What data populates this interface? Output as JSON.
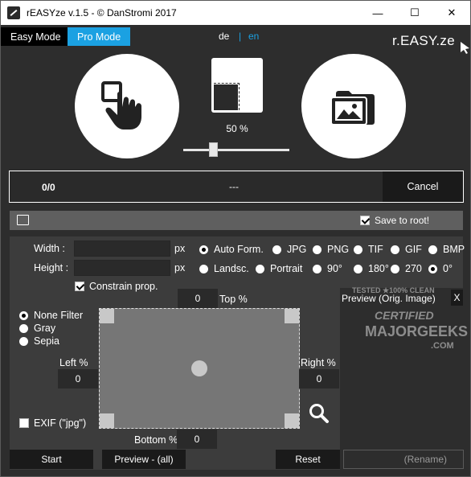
{
  "window": {
    "title": "rEASYze v.1.5 - © DanStromi 2017",
    "minimize": "—",
    "maximize": "☐",
    "close": "✕"
  },
  "modes": {
    "easy": "Easy Mode",
    "pro": "Pro Mode"
  },
  "languages": {
    "de": "de",
    "separator": "|",
    "en": "en"
  },
  "logo": "r.EASY.ze",
  "scale": {
    "percent_label": "50 %",
    "value_percent": 50
  },
  "progress": {
    "count": "0/0",
    "status": "---",
    "cancel": "Cancel"
  },
  "toolbar": {
    "save_to_root": "Save to root!",
    "save_to_root_checked": true
  },
  "size": {
    "width_label": "Width :",
    "height_label": "Height :",
    "unit": "px",
    "width_value": "",
    "height_value": ""
  },
  "format_options": [
    "Auto Form.",
    "JPG",
    "PNG",
    "TIF",
    "GIF",
    "BMP"
  ],
  "format_selected": "Auto Form.",
  "orientation_options": [
    "Landsc.",
    "Portrait",
    "90°",
    "180°",
    "270",
    "0°"
  ],
  "orientation_selected": "0°",
  "constrain": {
    "label": "Constrain prop.",
    "checked": true
  },
  "filters": {
    "options": [
      "None Filter",
      "Gray",
      "Sepia"
    ],
    "selected": "None Filter"
  },
  "crop": {
    "top_label": "Top %",
    "top_value": "0",
    "left_label": "Left %",
    "left_value": "0",
    "right_label": "Right %",
    "right_value": "0",
    "bottom_label": "Bottom %",
    "bottom_value": "0"
  },
  "exif": {
    "label": "EXIF (\"jpg\")",
    "checked": false
  },
  "preview": {
    "title": "Preview (Orig. Image)",
    "close": "X",
    "rename": "(Rename)"
  },
  "buttons": {
    "start": "Start",
    "preview_all": "Preview - (all)",
    "reset": "Reset"
  },
  "watermark": {
    "line1": "TESTED ★100% CLEAN",
    "line2": "CERTIFIED",
    "line3": "MAJORGEEKS",
    "line4": ".COM"
  },
  "colors": {
    "accent": "#1ba1e2",
    "background": "#2d2d2d",
    "panel": "#3c3c3c"
  }
}
